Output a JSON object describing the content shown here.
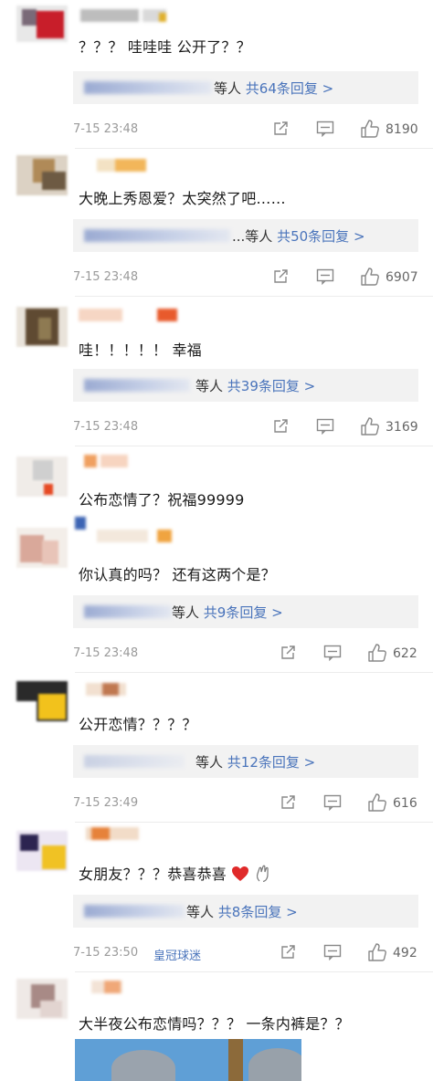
{
  "colors": {
    "link_blue": "#4a74bb",
    "meta_gray": "#9a9a9a",
    "reply_bg": "#f2f2f2",
    "heart_red": "#e02a2a"
  },
  "comments": [
    {
      "text": "？？？ 哇哇哇 公开了？？",
      "reply_suffix": "等人",
      "reply_count": "共64条回复 >",
      "time": "7-15 23:48",
      "likes": "8190"
    },
    {
      "text": "大晚上秀恩爱？太突然了吧……",
      "reply_suffix": "...等人",
      "reply_count": "共50条回复 >",
      "time": "7-15 23:48",
      "likes": "6907"
    },
    {
      "text": "哇！！！！！ 幸福",
      "reply_suffix": "等人",
      "reply_count": "共39条回复 >",
      "time": "7-15 23:48",
      "likes": "3169"
    },
    {
      "text": "公布恋情了？祝福99999"
    },
    {
      "text": "你认真的吗？ 还有这两个是？",
      "reply_suffix": "等人",
      "reply_count": "共9条回复 >",
      "time": "7-15 23:48",
      "likes": "622"
    },
    {
      "text": "公开恋情？？？？",
      "reply_suffix": "等人",
      "reply_count": "共12条回复 >",
      "time": "7-15 23:49",
      "likes": "616"
    },
    {
      "text": "女朋友？？？恭喜恭喜",
      "reply_suffix": "等人",
      "reply_count": "共8条回复 >",
      "time": "7-15 23:50",
      "fan_badge": "皇冠球迷",
      "likes": "492"
    },
    {
      "text": "大半夜公布恋情吗？？？ 一条内裤是？？"
    }
  ]
}
